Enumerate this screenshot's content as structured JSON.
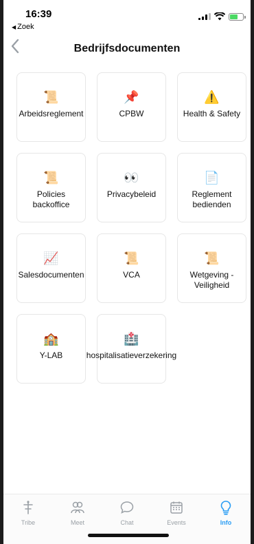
{
  "status": {
    "time": "16:39",
    "back_app": "Zoek"
  },
  "nav": {
    "back_icon": "chevron-left-icon",
    "title": "Bedrijfsdocumenten"
  },
  "tiles": [
    {
      "label": "Arbeidsreglement",
      "icon": "scroll-icon",
      "glyph": "📜"
    },
    {
      "label": "CPBW",
      "icon": "pushpin-icon",
      "glyph": "📌"
    },
    {
      "label": "Health & Safety",
      "icon": "warning-icon",
      "glyph": "⚠️"
    },
    {
      "label": "Policies backoffice",
      "icon": "scroll-icon",
      "glyph": "📜"
    },
    {
      "label": "Privacybeleid",
      "icon": "eyes-icon",
      "glyph": "👀"
    },
    {
      "label": "Reglement bedienden",
      "icon": "page-icon",
      "glyph": "📄"
    },
    {
      "label": "Salesdocumenten",
      "icon": "chart-increasing-icon",
      "glyph": "📈"
    },
    {
      "label": "VCA",
      "icon": "scroll-icon",
      "glyph": "📜"
    },
    {
      "label": "Wetgeving - Veiligheid",
      "icon": "scroll-icon",
      "glyph": "📜"
    },
    {
      "label": "Y-LAB",
      "icon": "building-icon",
      "glyph": "🏫"
    },
    {
      "label": "hospitalisatieverzekering",
      "icon": "hospital-icon",
      "glyph": "🏥"
    }
  ],
  "tabs": [
    {
      "label": "Tribe",
      "icon": "tribe-icon"
    },
    {
      "label": "Meet",
      "icon": "people-icon"
    },
    {
      "label": "Chat",
      "icon": "chat-bubble-icon"
    },
    {
      "label": "Events",
      "icon": "calendar-icon"
    },
    {
      "label": "Info",
      "icon": "lightbulb-icon",
      "active": true
    }
  ],
  "colors": {
    "accent": "#2a9df4",
    "inactive": "#9aa0a6",
    "battery": "#4cd964"
  }
}
